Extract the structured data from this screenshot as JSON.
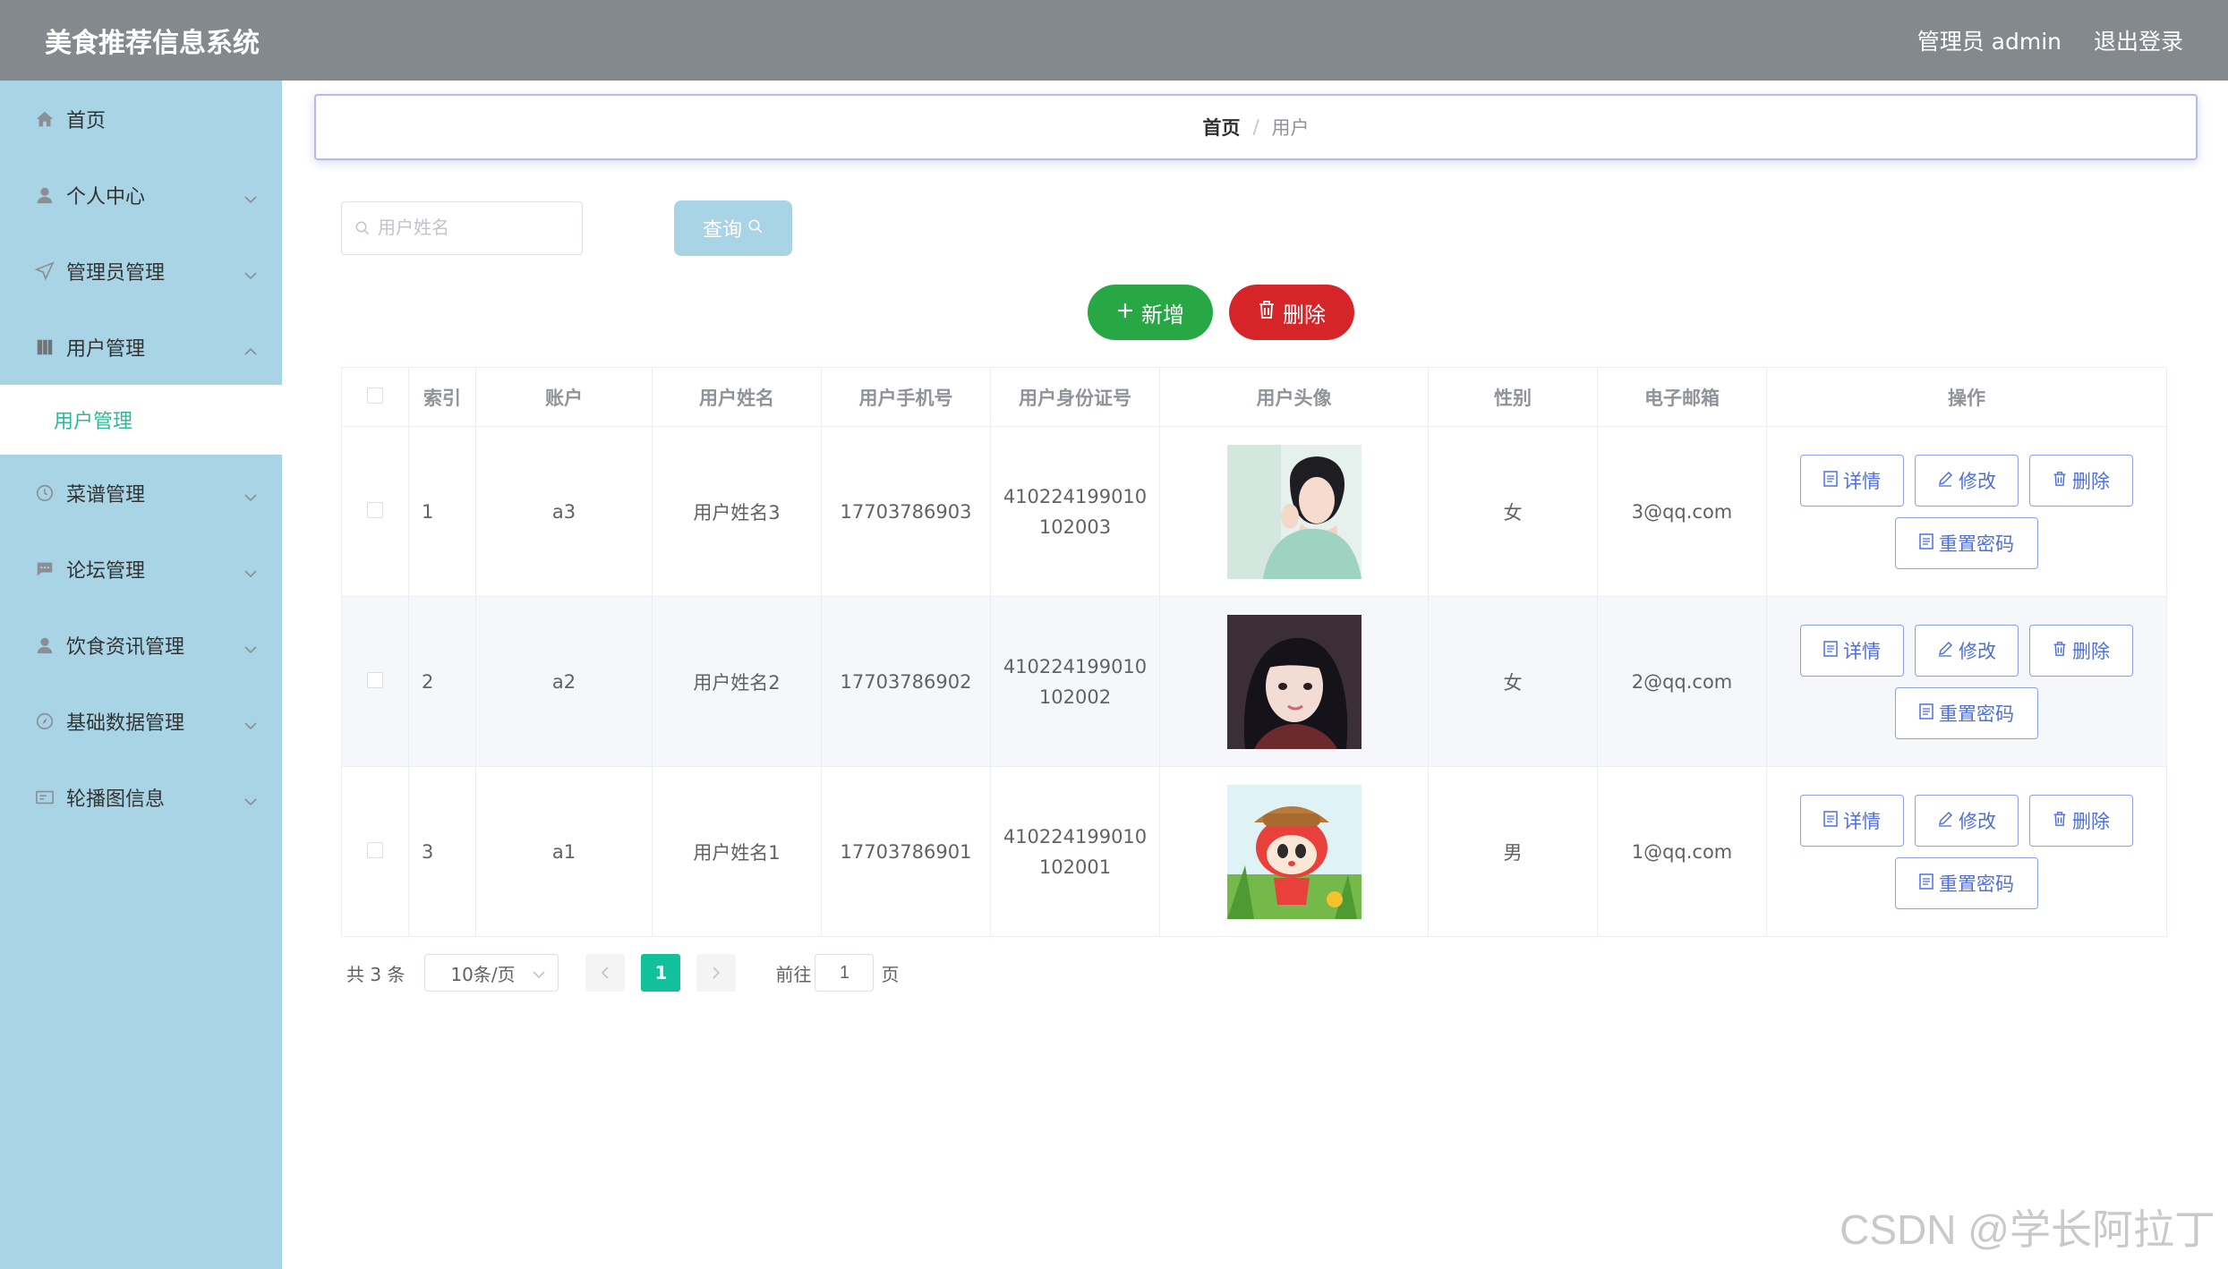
{
  "app": {
    "title": "美食推荐信息系统",
    "admin_label": "管理员 admin",
    "logout_label": "退出登录"
  },
  "sidebar": {
    "items": [
      {
        "label": "首页",
        "icon": "home-icon"
      },
      {
        "label": "个人中心",
        "icon": "user-icon"
      },
      {
        "label": "管理员管理",
        "icon": "send-icon"
      },
      {
        "label": "用户管理",
        "icon": "book-icon",
        "expanded": true
      },
      {
        "label": "菜谱管理",
        "icon": "clock-icon"
      },
      {
        "label": "论坛管理",
        "icon": "chat-icon"
      },
      {
        "label": "饮食资讯管理",
        "icon": "user-icon"
      },
      {
        "label": "基础数据管理",
        "icon": "compass-icon"
      },
      {
        "label": "轮播图信息",
        "icon": "card-icon"
      }
    ],
    "submenu_label": "用户管理"
  },
  "breadcrumb": {
    "home": "首页",
    "separator": "/",
    "current": "用户"
  },
  "search": {
    "placeholder": "用户姓名",
    "query_label": "查询"
  },
  "toolbar": {
    "add_label": "新增",
    "delete_label": "删除"
  },
  "table": {
    "headers": [
      "索引",
      "账户",
      "用户姓名",
      "用户手机号",
      "用户身份证号",
      "用户头像",
      "性别",
      "电子邮箱",
      "操作"
    ],
    "rows": [
      {
        "index": "1",
        "account": "a3",
        "name": "用户姓名3",
        "phone": "17703786903",
        "id_line1": "410224199010",
        "id_line2": "102003",
        "gender": "女",
        "email": "3@qq.com",
        "avatar": "woman-photo"
      },
      {
        "index": "2",
        "account": "a2",
        "name": "用户姓名2",
        "phone": "17703786902",
        "id_line1": "410224199010",
        "id_line2": "102002",
        "gender": "女",
        "email": "2@qq.com",
        "avatar": "girl-photo"
      },
      {
        "index": "3",
        "account": "a1",
        "name": "用户姓名1",
        "phone": "17703786901",
        "id_line1": "410224199010",
        "id_line2": "102001",
        "gender": "男",
        "email": "1@qq.com",
        "avatar": "cartoon-photo"
      }
    ],
    "actions": {
      "detail": "详情",
      "edit": "修改",
      "delete": "删除",
      "reset_pwd": "重置密码"
    }
  },
  "pagination": {
    "total": "共 3 条",
    "page_size": "10条/页",
    "current_page": "1",
    "goto_label": "前往",
    "goto_value": "1",
    "page_suffix": "页"
  },
  "watermark": "CSDN @学长阿拉丁",
  "colors": {
    "topbar": "#84898e",
    "sidebar": "#a8d4e6",
    "accent": "#13c09c",
    "add": "#27a845",
    "delete": "#d52529",
    "action": "#4e6ee0"
  }
}
